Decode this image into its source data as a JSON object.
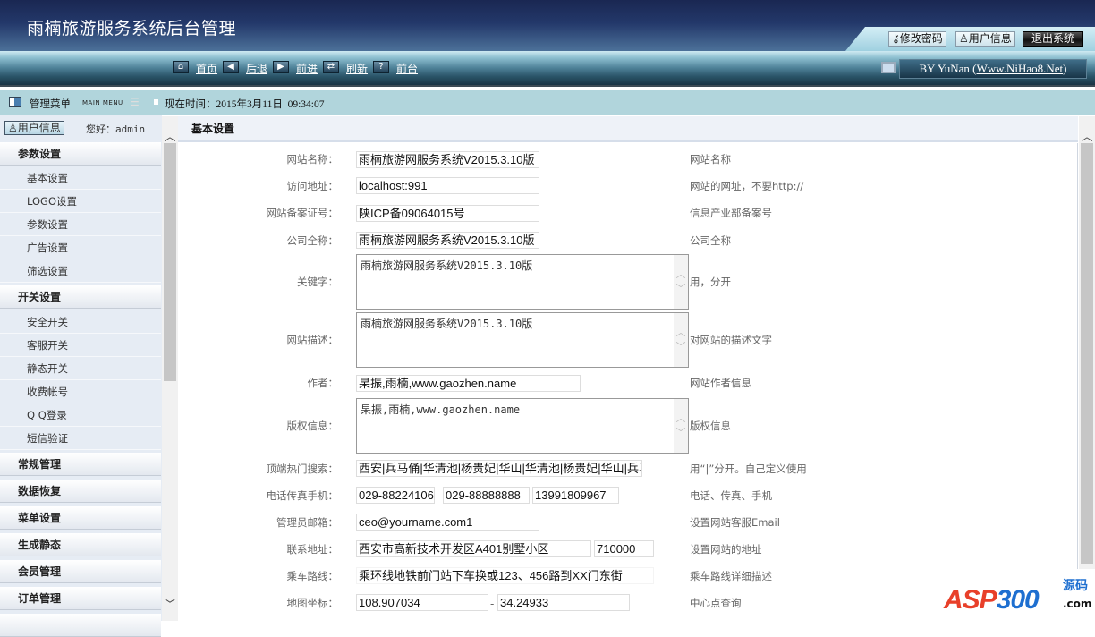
{
  "header": {
    "title": "雨楠旅游服务系统后台管理",
    "buttons": {
      "change_password": "修改密码",
      "user_info": "用户信息",
      "logout": "退出系统"
    }
  },
  "nav": {
    "home": "首页",
    "back": "后退",
    "forward": "前进",
    "refresh": "刷新",
    "front": "前台",
    "brand_prefix": "BY YuNan (",
    "brand_link": "Www.NiHao8.Net",
    "brand_suffix": ")"
  },
  "menubar": {
    "title": "管理菜单",
    "subtitle": "MAIN MENU",
    "time_label": "现在时间：2015年3月11日  09:34:07"
  },
  "sidebar": {
    "user_button": "用户信息",
    "greeting": "您好：admin",
    "groups": [
      {
        "label": "参数设置",
        "items": [
          "基本设置",
          "LOGO设置",
          "参数设置",
          "广告设置",
          "筛选设置"
        ]
      },
      {
        "label": "开关设置",
        "items": [
          "安全开关",
          "客服开关",
          "静态开关",
          "收费帐号",
          "Q Q登录",
          "短信验证"
        ]
      },
      {
        "label": "常规管理"
      },
      {
        "label": "数据恢复"
      },
      {
        "label": "菜单设置"
      },
      {
        "label": "生成静态"
      },
      {
        "label": "会员管理"
      },
      {
        "label": "订单管理"
      }
    ]
  },
  "main": {
    "title": "基本设置",
    "fields": {
      "site_name": {
        "label": "网站名称：",
        "value": "雨楠旅游网服务系统V2015.3.10版",
        "desc": "网站名称"
      },
      "url": {
        "label": "访问地址：",
        "value": "localhost:991",
        "desc": "网站的网址，不要http://"
      },
      "icp": {
        "label": "网站备案证号：",
        "value": "陕ICP备09064015号",
        "desc": "信息产业部备案号"
      },
      "company": {
        "label": "公司全称：",
        "value": "雨楠旅游网服务系统V2015.3.10版",
        "desc": "公司全称"
      },
      "keywords": {
        "label": "关键字：",
        "value": "雨楠旅游网服务系统V2015.3.10版",
        "desc": "用，分开"
      },
      "description": {
        "label": "网站描述：",
        "value": "雨楠旅游网服务系统V2015.3.10版",
        "desc": "对网站的描述文字"
      },
      "author": {
        "label": "作者：",
        "value": "杲振,雨楠,www.gaozhen.name",
        "desc": "网站作者信息"
      },
      "copyright": {
        "label": "版权信息：",
        "value": "杲振,雨楠,www.gaozhen.name",
        "desc": "版权信息"
      },
      "hot_search": {
        "label": "顶端热门搜索：",
        "value": "西安|兵马俑|华清池|杨贵妃|华山|华清池|杨贵妃|华山|兵马俑",
        "desc": "用“|”分开。自己定义使用"
      },
      "phone": {
        "label": "电话传真手机：",
        "tel": "029-88224106",
        "fax": "029-88888888",
        "mobile": "13991809967",
        "desc": "电话、传真、手机"
      },
      "email": {
        "label": "管理员邮箱：",
        "value": "ceo@yourname.com1",
        "desc": "设置网站客服Email"
      },
      "address": {
        "label": "联系地址：",
        "value": "西安市高新技术开发区A401别墅小区",
        "zip": "710000",
        "desc": "设置网站的地址"
      },
      "route": {
        "label": "乘车路线：",
        "value": "乘环线地铁前门站下车换或123、456路到XX门东街",
        "desc": "乘车路线详细描述"
      },
      "map": {
        "label": "地图坐标：",
        "lng": "108.907034",
        "sep": "-",
        "lat": "34.24933",
        "desc": "中心点查询"
      }
    }
  },
  "watermark": {
    "text": "ASP300",
    "sub1": "源码",
    "sub2": ".com"
  }
}
